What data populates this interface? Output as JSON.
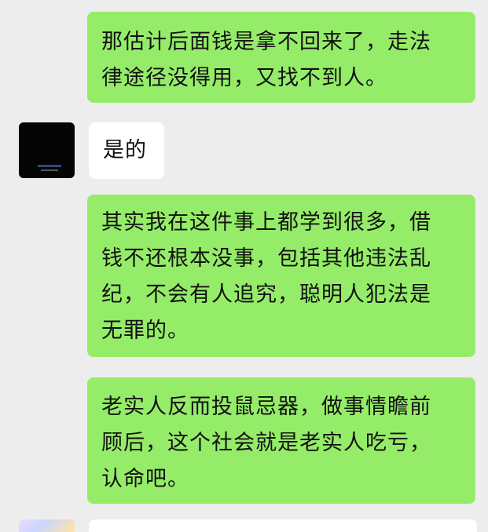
{
  "messages": [
    {
      "id": "m1",
      "direction": "sent",
      "lines": [
        "那估计后面钱是拿不回来了，走法",
        "律途径没得用，又找不到人。"
      ]
    },
    {
      "id": "m2",
      "direction": "received",
      "lines": [
        "是的"
      ]
    },
    {
      "id": "m3",
      "direction": "sent",
      "lines": [
        "其实我在这件事上都学到很多，借",
        "钱不还根本没事，包括其他违法乱",
        "纪，不会有人追究，聪明人犯法是",
        "无罪的。"
      ]
    },
    {
      "id": "m4",
      "direction": "sent",
      "lines": [
        "老实人反而投鼠忌器，做事情瞻前",
        "顾后，这个社会就是老实人吃亏，",
        "认命吧。"
      ]
    }
  ],
  "colors": {
    "background": "#ededed",
    "sent_bubble": "#95ec69",
    "received_bubble": "#ffffff",
    "text": "#111111"
  },
  "icons": {
    "contact_avatar": "dark-avatar-icon",
    "next_avatar": "pastel-avatar-icon"
  }
}
